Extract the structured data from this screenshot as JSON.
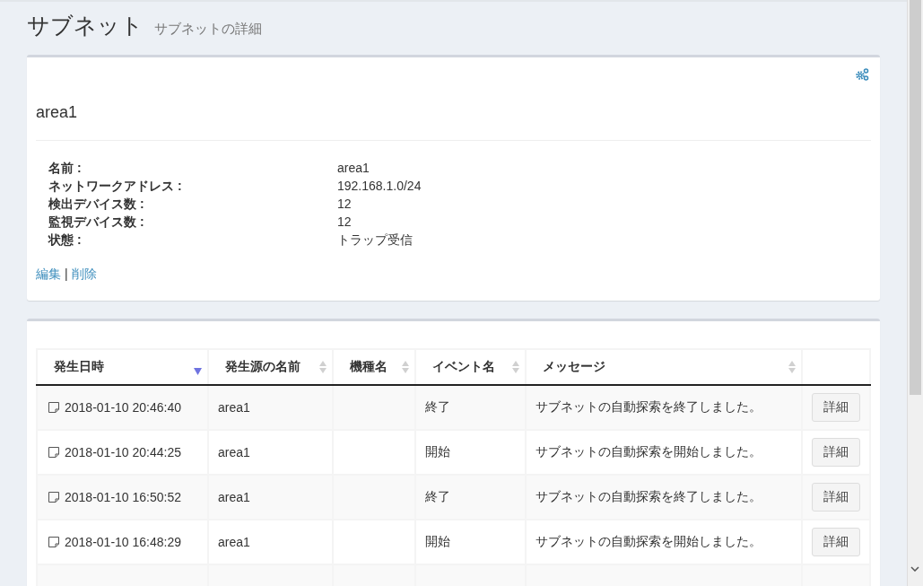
{
  "header": {
    "title": "サブネット",
    "subtitle": "サブネットの詳細"
  },
  "detail": {
    "name": "area1",
    "fields": [
      {
        "label": "名前 :",
        "value": "area1"
      },
      {
        "label": "ネットワークアドレス :",
        "value": "192.168.1.0/24"
      },
      {
        "label": "検出デバイス数 :",
        "value": "12"
      },
      {
        "label": "監視デバイス数 :",
        "value": "12"
      },
      {
        "label": "状態 :",
        "value": "トラップ受信"
      }
    ],
    "links": [
      "編集",
      "削除"
    ],
    "separator": "|"
  },
  "table": {
    "columns": [
      {
        "kind": "sortable",
        "label": "発生日時",
        "sorted": true
      },
      {
        "kind": "sortable",
        "label": "発生源の名前",
        "sorted": false
      },
      {
        "kind": "sortable",
        "label": "機種名",
        "sorted": false
      },
      {
        "kind": "sortable",
        "label": "イベント名",
        "sorted": false
      },
      {
        "kind": "sortable",
        "label": "メッセージ",
        "sorted": false
      },
      {
        "kind": "action"
      }
    ],
    "rows": [
      {
        "time": "2018-01-10 20:46:40",
        "source": "area1",
        "event": "終了",
        "message": "サブネットの自動探索を終了しました。",
        "button": "詳細"
      },
      {
        "time": "2018-01-10 20:44:25",
        "source": "area1",
        "event": "開始",
        "message": "サブネットの自動探索を開始しました。",
        "button": "詳細"
      },
      {
        "time": "2018-01-10 16:50:52",
        "source": "area1",
        "event": "終了",
        "message": "サブネットの自動探索を終了しました。",
        "button": "詳細"
      },
      {
        "time": "2018-01-10 16:48:29",
        "source": "area1",
        "event": "開始",
        "message": "サブネットの自動探索を開始しました。",
        "button": "詳細"
      }
    ]
  }
}
